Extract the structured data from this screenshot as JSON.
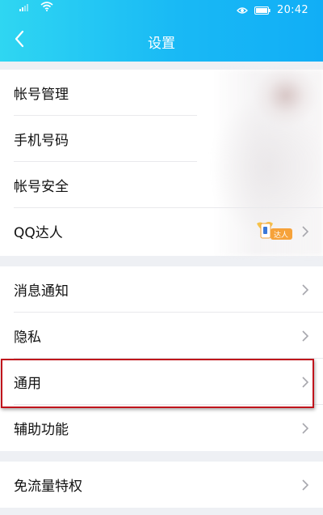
{
  "status_bar": {
    "time": "20:42"
  },
  "header": {
    "title": "设置"
  },
  "groups": [
    {
      "items": [
        {
          "label": "帐号管理"
        },
        {
          "label": "手机号码"
        },
        {
          "label": "帐号安全"
        },
        {
          "label": "QQ达人",
          "badge_text": "达人"
        }
      ]
    },
    {
      "items": [
        {
          "label": "消息通知"
        },
        {
          "label": "隐私"
        },
        {
          "label": "通用"
        },
        {
          "label": "辅助功能"
        }
      ]
    },
    {
      "items": [
        {
          "label": "免流量特权"
        }
      ]
    }
  ],
  "colors": {
    "header_start": "#2fd6f2",
    "header_end": "#11aef6",
    "highlight": "#c0141c",
    "chevron": "#a7a7ad",
    "background": "#eef0f4"
  },
  "icons": [
    "signal-icon",
    "wifi-icon",
    "eye-icon",
    "battery-icon",
    "back-arrow-icon",
    "chevron-right-icon",
    "qq-master-badge-icon"
  ]
}
